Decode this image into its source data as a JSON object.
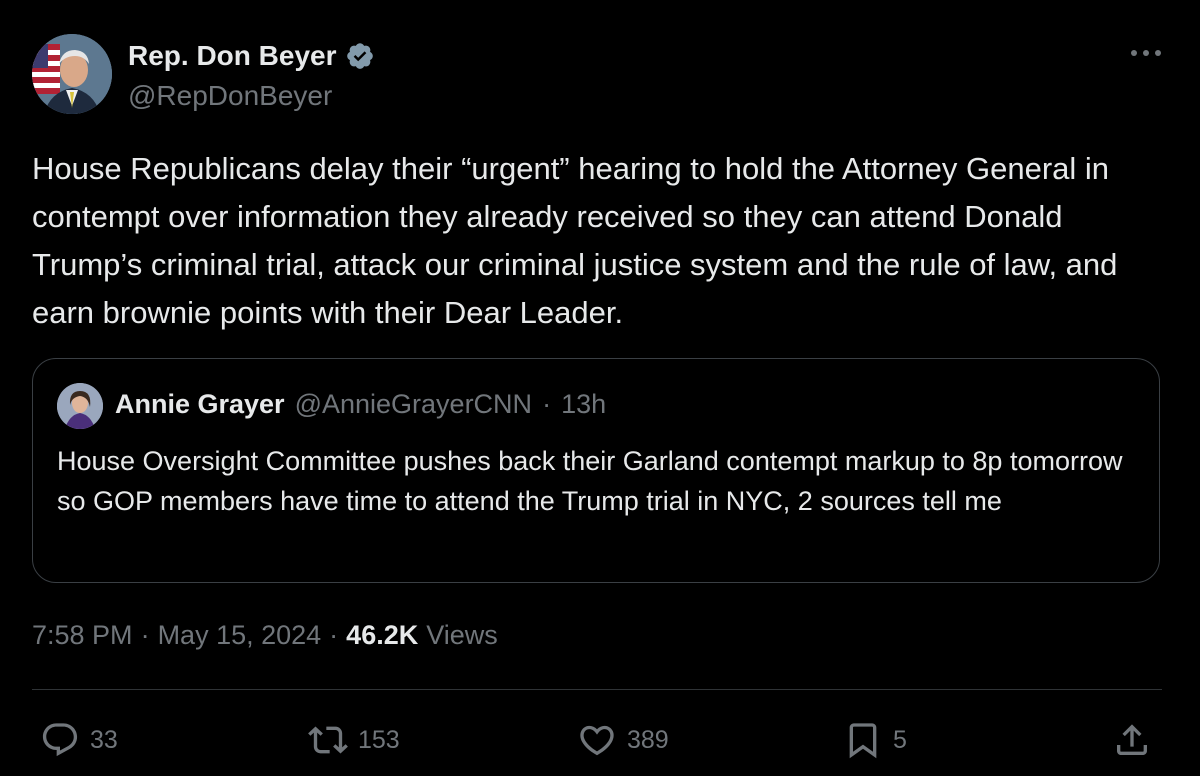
{
  "author": {
    "name": "Rep. Don Beyer",
    "handle": "@RepDonBeyer",
    "verified_icon": "verified-badge-icon"
  },
  "tweet": {
    "text": "House Republicans delay their “urgent” hearing to hold the Attorney General in contempt over information they already received so they can attend Donald Trump’s criminal trial, attack our criminal justice system and the rule of law, and earn brownie points with their Dear Leader."
  },
  "quote": {
    "name": "Annie Grayer",
    "handle": "@AnnieGrayerCNN",
    "separator": "·",
    "time": "13h",
    "text": "House Oversight Committee pushes back their Garland contempt markup to 8p tomorrow so GOP members have time to attend the Trump trial in NYC, 2 sources tell me"
  },
  "meta": {
    "time": "7:58 PM",
    "separator": "·",
    "date": "May 15, 2024",
    "views_count": "46.2K",
    "views_label": "Views"
  },
  "actions": {
    "replies": "33",
    "reposts": "153",
    "likes": "389",
    "bookmarks": "5"
  },
  "colors": {
    "background": "#000000",
    "text": "#e7e9ea",
    "secondary": "#71767b",
    "border": "#2f3336",
    "verified": "#829aab"
  }
}
